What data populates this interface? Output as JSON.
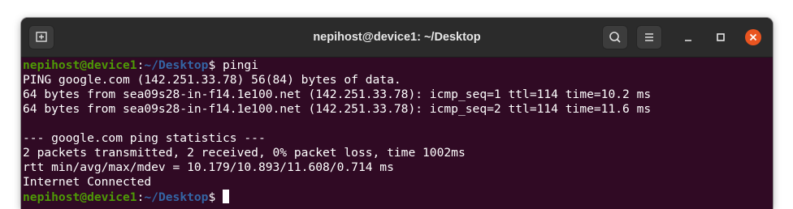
{
  "window": {
    "title": "nepihost@device1: ~/Desktop"
  },
  "icons": {
    "new_tab": "new-tab-icon",
    "search": "search-icon",
    "menu": "hamburger-menu-icon",
    "minimize": "minimize-icon",
    "maximize": "maximize-icon",
    "close": "close-icon"
  },
  "colors": {
    "terminal_bg": "#300a24",
    "prompt_user": "#4e9a06",
    "prompt_path": "#3465a4",
    "close_button": "#e95420"
  },
  "prompt": {
    "user_host": "nepihost@device1",
    "separator": ":",
    "path": "~/Desktop",
    "symbol": "$ "
  },
  "terminal": {
    "command": "pingi",
    "output": [
      "PING google.com (142.251.33.78) 56(84) bytes of data.",
      "64 bytes from sea09s28-in-f14.1e100.net (142.251.33.78): icmp_seq=1 ttl=114 time=10.2 ms",
      "64 bytes from sea09s28-in-f14.1e100.net (142.251.33.78): icmp_seq=2 ttl=114 time=11.6 ms",
      "",
      "--- google.com ping statistics ---",
      "2 packets transmitted, 2 received, 0% packet loss, time 1002ms",
      "rtt min/avg/max/mdev = 10.179/10.893/11.608/0.714 ms",
      "Internet Connected"
    ]
  }
}
